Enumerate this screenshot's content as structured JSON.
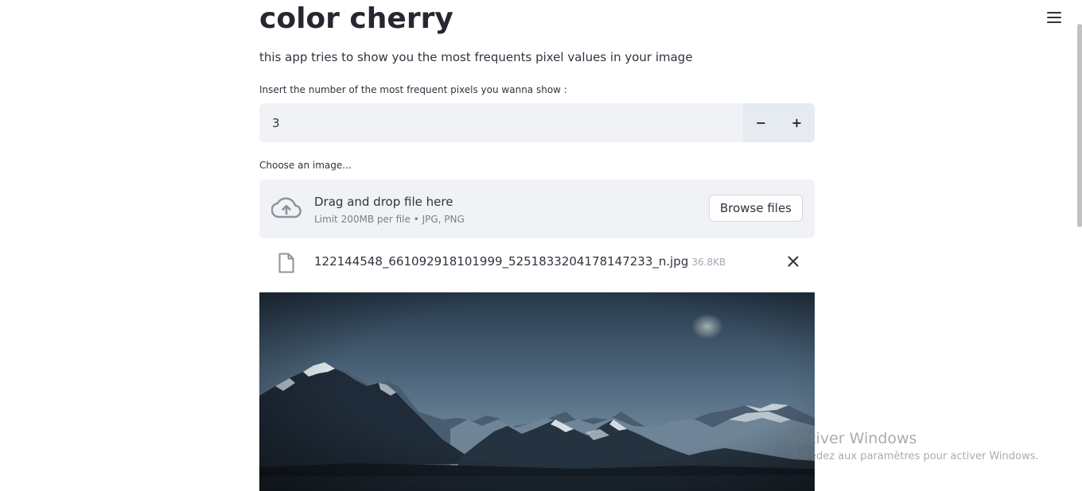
{
  "app": {
    "title": "color cherry",
    "description": "this app tries to show you the most frequents pixel values in your image"
  },
  "number_input": {
    "label": "Insert the number of the most frequent pixels you wanna show :",
    "value": "3",
    "decrement_label": "−",
    "increment_label": "+"
  },
  "uploader": {
    "label": "Choose an image...",
    "drop_text": "Drag and drop file here",
    "limit_text": "Limit 200MB per file • JPG, PNG",
    "browse_label": "Browse files",
    "file": {
      "name": "122144548_661092918101999_5251833204178147233_n.jpg",
      "size": "36.8KB"
    }
  },
  "icons": {
    "menu": "hamburger-menu-icon",
    "upload": "cloud-upload-icon",
    "file": "file-icon",
    "remove": "close-icon"
  },
  "windows_watermark": {
    "title": "Activer Windows",
    "subtitle": "Accédez aux paramètres pour activer Windows."
  },
  "colors": {
    "input_bg": "#f0f2f6",
    "text": "#31333f",
    "muted": "#7d7f88"
  }
}
